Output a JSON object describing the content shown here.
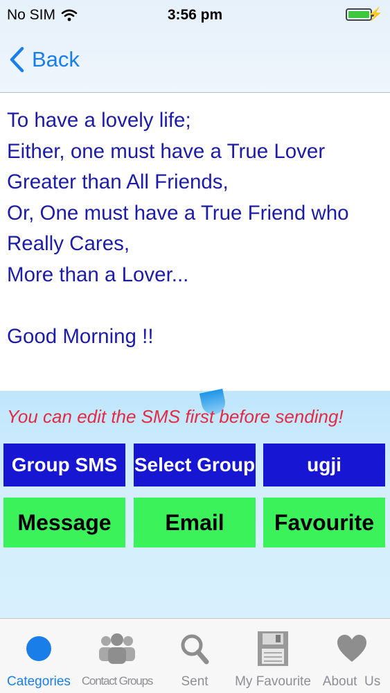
{
  "status_bar": {
    "carrier": "No SIM",
    "time": "3:56 pm",
    "wifi_icon": "wifi-icon",
    "battery_icon": "battery-charging-icon"
  },
  "nav": {
    "back_label": "Back"
  },
  "message": {
    "text": "To have a lovely life;\nEither, one must have a True Lover\nGreater than All Friends,\nOr, One must have a True Friend who\nReally Cares,\nMore than a Lover...\n\nGood Morning !!"
  },
  "edit_hint": "You can edit the SMS first before sending!",
  "buttons": {
    "group_sms": "Group SMS",
    "select_group": "Select Group",
    "group_name": "ugji",
    "message": "Message",
    "email": "Email",
    "favourite": "Favourite"
  },
  "tabs": [
    {
      "label": "Categories",
      "icon": "circle-icon",
      "active": true
    },
    {
      "label": "Contact Groups",
      "icon": "contacts-icon",
      "active": false
    },
    {
      "label": "Sent",
      "icon": "search-icon",
      "active": false
    },
    {
      "label": "My Favourite",
      "icon": "save-icon",
      "active": false
    },
    {
      "label": "About  Us",
      "icon": "heart-icon",
      "active": false
    }
  ],
  "colors": {
    "accent": "#1a7ee8",
    "message_text": "#1c1ca8",
    "hint_text": "#e22a45",
    "blue_button": "#1717d3",
    "green_button": "#3bf25a"
  }
}
